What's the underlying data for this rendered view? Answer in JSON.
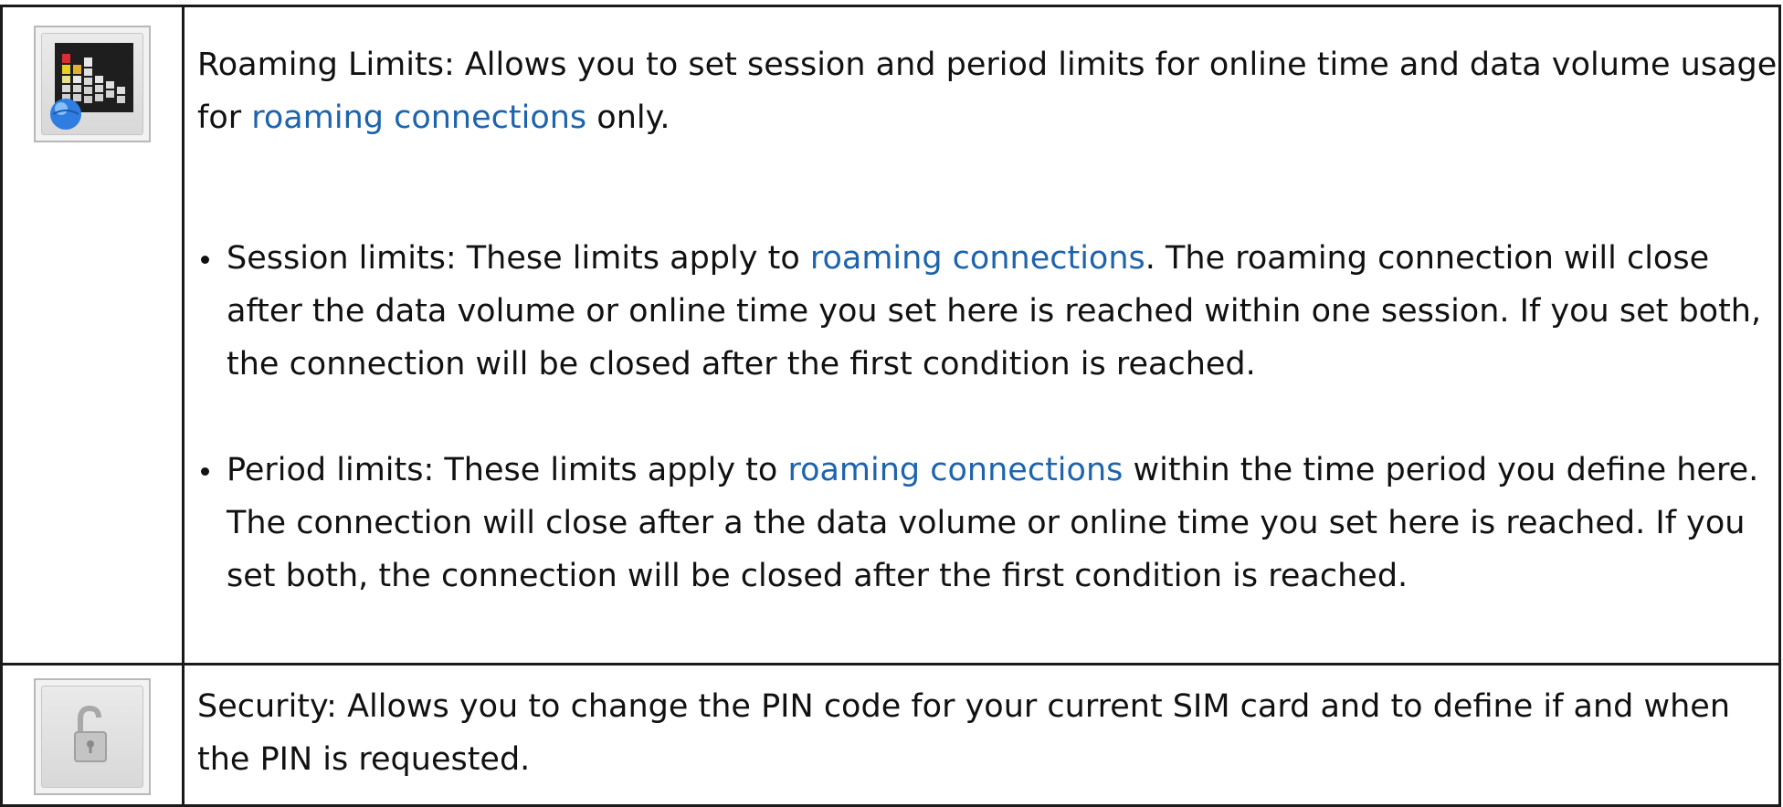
{
  "rows": [
    {
      "icon": "roaming-limits-icon",
      "title": "Roaming Limits",
      "intro": {
        "before": "Roaming Limits: Allows you to set session and period limits for online time and data volume usage for ",
        "link": "roaming connections",
        "after": " only."
      },
      "bullets": [
        {
          "before": "Session limits: These limits apply to ",
          "link": "roaming connections",
          "after": ". The roaming connection will close after the data volume or online time you set here is reached within one session. If you set both, the connection will be closed after the first condition is reached."
        },
        {
          "before": "Period limits: These limits apply to ",
          "link": "roaming connections",
          "after": " within the time period you define here. The connection will close after a the data volume or online time you set here is reached. If you set both, the connection will be closed after the first condition is reached."
        }
      ]
    },
    {
      "icon": "padlock-open-icon",
      "title": "Security",
      "intro": {
        "text": "Security: Allows you to change the PIN code for your current SIM card and to define if and when the PIN is requested."
      }
    }
  ],
  "colors": {
    "link": "#1d64ad",
    "border": "#1a1a1a",
    "text": "#111111"
  }
}
